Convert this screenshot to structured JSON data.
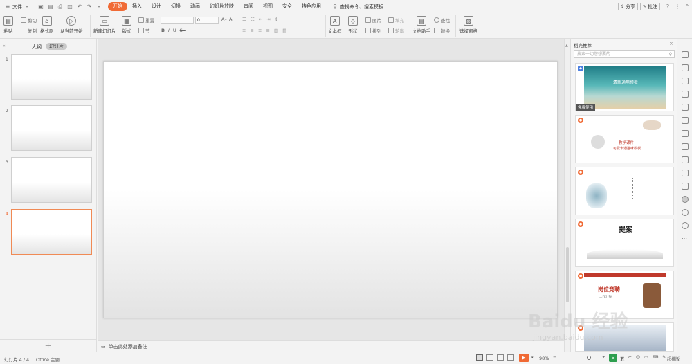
{
  "menubar": {
    "file_label": "文件",
    "tabs": [
      {
        "label": "开始",
        "active": true
      },
      {
        "label": "插入",
        "active": false
      },
      {
        "label": "设计",
        "active": false
      },
      {
        "label": "切换",
        "active": false
      },
      {
        "label": "动画",
        "active": false
      },
      {
        "label": "幻灯片放映",
        "active": false
      },
      {
        "label": "审阅",
        "active": false
      },
      {
        "label": "视图",
        "active": false
      },
      {
        "label": "安全",
        "active": false
      },
      {
        "label": "特色应用",
        "active": false
      }
    ],
    "search_label": "查找命令、搜索模板",
    "share_label": "分享",
    "comment_label": "批注",
    "accent_color": "#f06a35"
  },
  "ribbon": {
    "paste": "粘贴",
    "cut": "剪切",
    "copy": "复制",
    "format_painter": "格式刷",
    "play_from_current": "从当前开始",
    "new_slide": "新建幻灯片",
    "layout": "版式",
    "reset": "重置",
    "section": "节",
    "font_size_value": "0",
    "textbox": "文本框",
    "shape": "形状",
    "picture": "图片",
    "arrange": "排列",
    "fill": "填充",
    "outline": "轮廓",
    "doc_helper": "文档助手",
    "find": "查找",
    "replace": "替换",
    "select_pane": "选择窗格"
  },
  "leftpane": {
    "tab_outline": "大纲",
    "tab_slides": "幻灯片",
    "slide_numbers": [
      "1",
      "2",
      "3",
      "4"
    ],
    "selected_index": 3,
    "add_label": "+"
  },
  "notes": {
    "placeholder": "单击此处添加备注"
  },
  "rpanel": {
    "title": "稻壳推荐",
    "search_placeholder": "搜索一切您想要的",
    "cards": [
      {
        "title": "清新通用模板",
        "action": "免费使用"
      },
      {
        "title": "教学课件",
        "subtitle": "可爱卡通猫咪模板"
      },
      {
        "title": ""
      },
      {
        "title": "提案"
      },
      {
        "title": "岗位竞聘",
        "subtitle": "工作汇报"
      },
      {
        "title": ""
      }
    ]
  },
  "status": {
    "slide_info": "幻灯片 4 / 4",
    "theme": "Office 主题",
    "zoom": "98%",
    "ime": "五",
    "watermark": "Baidu 经验",
    "watermark_url": "jingyan.baidu.com",
    "extra": "超排版"
  }
}
